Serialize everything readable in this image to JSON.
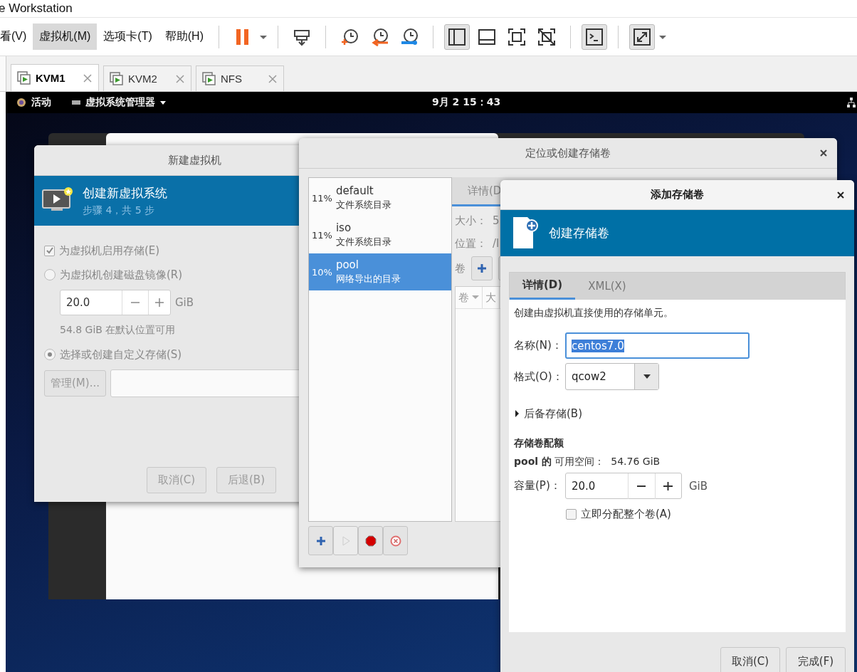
{
  "app_title": "e Workstation",
  "menus": [
    {
      "label": "看(V)",
      "selected": false
    },
    {
      "label": "虚拟机(M)",
      "selected": true
    },
    {
      "label": "选项卡(T)",
      "selected": false
    },
    {
      "label": "帮助(H)",
      "selected": false
    }
  ],
  "toolbar": [
    {
      "kind": "pause",
      "pressed": false
    },
    {
      "kind": "caret",
      "pressed": false
    },
    {
      "kind": "sep"
    },
    {
      "kind": "send",
      "pressed": false
    },
    {
      "kind": "sep"
    },
    {
      "kind": "snap-take",
      "pressed": false
    },
    {
      "kind": "snap-revert",
      "pressed": false
    },
    {
      "kind": "snap-manage",
      "pressed": false
    },
    {
      "kind": "sep"
    },
    {
      "kind": "view-sidebar",
      "pressed": true
    },
    {
      "kind": "view-bottom",
      "pressed": false
    },
    {
      "kind": "view-fit",
      "pressed": false
    },
    {
      "kind": "view-nofit",
      "pressed": false
    },
    {
      "kind": "sep"
    },
    {
      "kind": "console",
      "pressed": true
    },
    {
      "kind": "sep"
    },
    {
      "kind": "fullscreen",
      "pressed": true
    },
    {
      "kind": "caret",
      "pressed": false
    }
  ],
  "vm_tabs": [
    {
      "label": "KVM1",
      "selected": true
    },
    {
      "label": "KVM2",
      "selected": false
    },
    {
      "label": "NFS",
      "selected": false
    }
  ],
  "guest_topbar": {
    "activities": "活动",
    "app_menu": "虚拟系统管理器",
    "clock": "9月 2 15：43"
  },
  "new_vm_dialog": {
    "title": "新建虚拟机",
    "header_title": "创建新虚拟系统",
    "header_step": "步骤 4，共 5 步",
    "enable_storage": {
      "label": "为虚拟机启用存储(E)",
      "checked": true
    },
    "options": [
      {
        "label": "为虚拟机创建磁盘镜像(R)",
        "selected": false
      },
      {
        "label": "选择或创建自定义存储(S)",
        "selected": true
      }
    ],
    "disk_size": "20.0",
    "disk_unit": "GiB",
    "available": "54.8 GiB 在默认位置可用",
    "manage_button": "管理(M)...",
    "buttons": [
      "取消(C)",
      "后退(B)"
    ]
  },
  "locate_dialog": {
    "title": "定位或创建存储卷",
    "pools": [
      {
        "usage": "11%",
        "name": "default",
        "type": "文件系统目录",
        "selected": false
      },
      {
        "usage": "11%",
        "name": "iso",
        "type": "文件系统目录",
        "selected": false
      },
      {
        "usage": "10%",
        "name": "pool",
        "type": "网络导出的目录",
        "selected": true
      }
    ],
    "tab": "详情(D",
    "size_label": "大小：",
    "size_value": "5",
    "location_label": "位置：",
    "location_value": "/l",
    "volumes_label": "卷",
    "columns": [
      "卷",
      "大"
    ]
  },
  "add_volume_dialog": {
    "title": "添加存储卷",
    "header": "创建存储卷",
    "tabs": [
      {
        "label": "详情(D)",
        "selected": true
      },
      {
        "label": "XML(X)",
        "selected": false
      }
    ],
    "description": "创建由虚拟机直接使用的存储单元。",
    "name_label": "名称(N)：",
    "name_value": "centos7.0",
    "name_selected": true,
    "format_label": "格式(O)：",
    "format_value": "qcow2",
    "backing": {
      "label": "后备存储(B)",
      "expanded": false
    },
    "quota_title": "存储卷配额",
    "quota_available": "**pool 的** 可用空间：  54.76 GiB",
    "capacity_label": "容量(P)：",
    "capacity_value": "20.0",
    "capacity_unit": "GiB",
    "allocate": {
      "label": "立即分配整个卷(A)",
      "checked": false
    },
    "buttons": [
      "取消(C)",
      "完成(F)"
    ]
  }
}
